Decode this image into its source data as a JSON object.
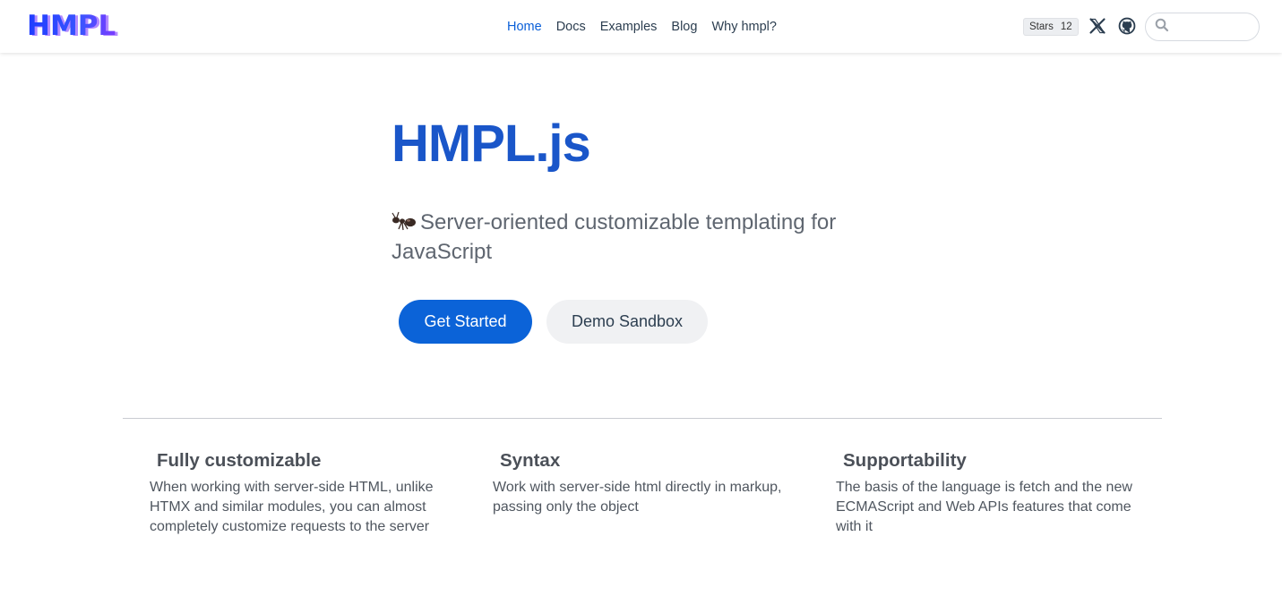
{
  "nav": {
    "logo": "HMPL",
    "links": [
      {
        "label": "Home",
        "active": true
      },
      {
        "label": "Docs",
        "active": false
      },
      {
        "label": "Examples",
        "active": false
      },
      {
        "label": "Blog",
        "active": false
      },
      {
        "label": "Why hmpl?",
        "active": false
      }
    ],
    "stars_label": "Stars",
    "stars_count": "12",
    "social_icons": [
      "x-twitter-icon",
      "github-icon"
    ],
    "search": {
      "icon": "search-icon",
      "value": "",
      "placeholder": ""
    }
  },
  "hero": {
    "title": "HMPL.js",
    "tagline_icon": "ant-icon",
    "tagline": "Server-oriented customizable templating for JavaScript",
    "primary_button": "Get Started",
    "secondary_button": "Demo Sandbox"
  },
  "features": [
    {
      "title": "Fully customizable",
      "text": "When working with server-side HTML, unlike HTMX and similar modules, you can almost completely customize requests to the server"
    },
    {
      "title": "Syntax",
      "text": "Work with server-side html directly in markup, passing only the object"
    },
    {
      "title": "Supportability",
      "text": "The basis of the language is fetch and the new ECMAScript and Web APIs features that come with it"
    }
  ],
  "colors": {
    "accent": "#0b63d8",
    "title": "#1a56c9",
    "logo": "#1f3cff"
  }
}
